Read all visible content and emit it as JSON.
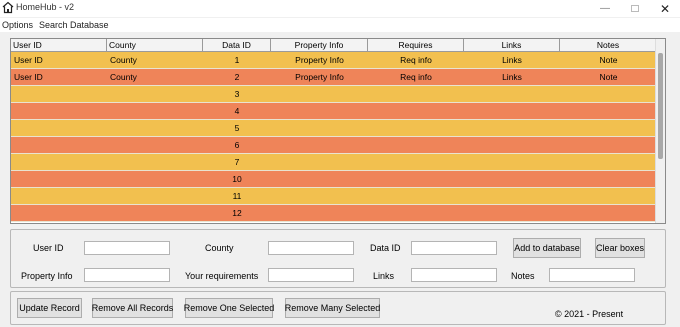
{
  "window": {
    "title": "HomeHub - v2"
  },
  "menu": {
    "items": [
      "Options",
      "Search Database"
    ]
  },
  "grid": {
    "columns": [
      "User ID",
      "County",
      "Data ID",
      "Property Info",
      "Requires",
      "Links",
      "Notes"
    ],
    "rows": [
      [
        "User ID",
        "County",
        "1",
        "Property Info",
        "Req info",
        "Links",
        "Note"
      ],
      [
        "User ID",
        "County",
        "2",
        "Property Info",
        "Req info",
        "Links",
        "Note"
      ],
      [
        "",
        "",
        "3",
        "",
        "",
        "",
        ""
      ],
      [
        "",
        "",
        "4",
        "",
        "",
        "",
        ""
      ],
      [
        "",
        "",
        "5",
        "",
        "",
        "",
        ""
      ],
      [
        "",
        "",
        "6",
        "",
        "",
        "",
        ""
      ],
      [
        "",
        "",
        "7",
        "",
        "",
        "",
        ""
      ],
      [
        "",
        "",
        "10",
        "",
        "",
        "",
        ""
      ],
      [
        "",
        "",
        "11",
        "",
        "",
        "",
        ""
      ],
      [
        "",
        "",
        "12",
        "",
        "",
        "",
        ""
      ]
    ],
    "row_colors": [
      "#f2c04f",
      "#ef8459"
    ]
  },
  "form": {
    "user_id_label": "User ID",
    "county_label": "County",
    "data_id_label": "Data ID",
    "property_info_label": "Property Info",
    "requirements_label": "Your requirements",
    "links_label": "Links",
    "notes_label": "Notes",
    "user_id_value": "",
    "county_value": "",
    "data_id_value": "",
    "property_info_value": "",
    "requirements_value": "",
    "links_value": "",
    "notes_value": "",
    "add_button": "Add to database",
    "clear_button": "Clear boxes"
  },
  "actions": {
    "update": "Update Record",
    "remove_all": "Remove All Records",
    "remove_one": "Remove One Selected",
    "remove_many": "Remove Many Selected"
  },
  "footer": {
    "copyright": "© 2021 - Present"
  },
  "icons": {
    "app": "home-icon",
    "minimize": "minimize-icon",
    "maximize": "maximize-icon",
    "close": "close-icon"
  }
}
